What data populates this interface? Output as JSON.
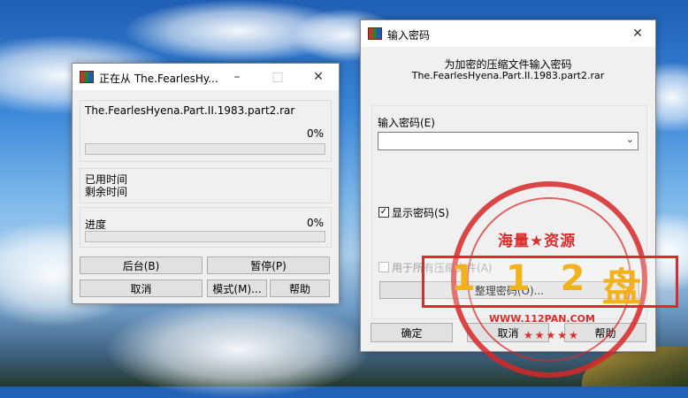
{
  "progress_dialog": {
    "title": "正在从 The.FearlesHy...",
    "filename": "The.FearlesHyena.Part.II.1983.part2.rar",
    "file_percent": "0%",
    "file_progress": 0,
    "elapsed_label": "已用时间",
    "remaining_label": "剩余时间",
    "total_label": "进度",
    "total_percent": "0%",
    "total_progress": 0,
    "buttons": {
      "background": "后台(B)",
      "pause": "暂停(P)",
      "cancel": "取消",
      "mode": "模式(M)...",
      "help": "帮助"
    }
  },
  "password_dialog": {
    "title": "输入密码",
    "heading": "为加密的压缩文件输入密码",
    "archive_name": "The.FearlesHyena.Part.II.1983.part2.rar",
    "password_label": "输入密码(E)",
    "password_value": "",
    "show_password_label": "显示密码(S)",
    "show_password_checked": true,
    "use_for_all_label": "用于所有压缩文件(A)",
    "use_for_all_checked": false,
    "organize_button": "整理密码(O)...",
    "ok_button": "确定",
    "cancel_button": "取消",
    "help_button": "帮助"
  },
  "watermark": {
    "top_text": "海量★资源",
    "digits": "112",
    "pan_char": "盘",
    "url": "WWW.112PAN.COM",
    "stars": "★★★★★",
    "color": "#d92d2d",
    "digit_color": "#f1b21a"
  },
  "colors": {
    "dialog_bg": "#f0f0f0",
    "progress_green": "#06b025"
  }
}
